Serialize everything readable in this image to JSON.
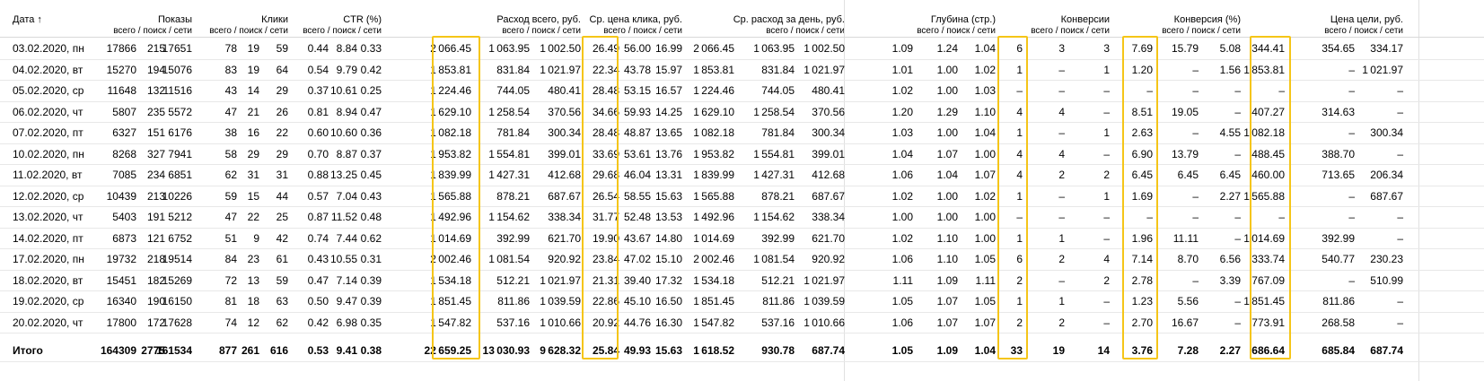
{
  "header": {
    "date": "Дата ↑",
    "groups": [
      {
        "label": "Показы",
        "sub": "всего / поиск / сети"
      },
      {
        "label": "Клики",
        "sub": "всего / поиск / сети"
      },
      {
        "label": "CTR (%)",
        "sub": "всего / поиск / сети"
      },
      {
        "label": "Расход всего, руб.",
        "sub": "всего / поиск / сети"
      },
      {
        "label": "Ср. цена клика, руб.",
        "sub": "всего / поиск / сети"
      },
      {
        "label": "Ср. расход за день, руб.",
        "sub": "всего / поиск / сети"
      },
      {
        "label": "Глубина (стр.)",
        "sub": "всего / поиск / сети"
      },
      {
        "label": "Конверсии",
        "sub": "всего / поиск / сети"
      },
      {
        "label": "Конверсия (%)",
        "sub": "всего / поиск / сети"
      },
      {
        "label": "Цена цели, руб.",
        "sub": "всего / поиск / сети"
      }
    ]
  },
  "rows": [
    {
      "date": "03.02.2020, пн",
      "v": [
        "17866",
        "215",
        "17651",
        "78",
        "19",
        "59",
        "0.44",
        "8.84",
        "0.33",
        "2066.45",
        "1063.95",
        "1002.50",
        "26.49",
        "56.00",
        "16.99",
        "2066.45",
        "1063.95",
        "1002.50",
        "1.09",
        "1.24",
        "1.04",
        "6",
        "3",
        "3",
        "7.69",
        "15.79",
        "5.08",
        "344.41",
        "354.65",
        "334.17"
      ]
    },
    {
      "date": "04.02.2020, вт",
      "v": [
        "15270",
        "194",
        "15076",
        "83",
        "19",
        "64",
        "0.54",
        "9.79",
        "0.42",
        "1853.81",
        "831.84",
        "1021.97",
        "22.34",
        "43.78",
        "15.97",
        "1853.81",
        "831.84",
        "1021.97",
        "1.01",
        "1.00",
        "1.02",
        "1",
        "–",
        "1",
        "1.20",
        "–",
        "1.56",
        "1853.81",
        "–",
        "1021.97"
      ]
    },
    {
      "date": "05.02.2020, ср",
      "v": [
        "11648",
        "132",
        "11516",
        "43",
        "14",
        "29",
        "0.37",
        "10.61",
        "0.25",
        "1224.46",
        "744.05",
        "480.41",
        "28.48",
        "53.15",
        "16.57",
        "1224.46",
        "744.05",
        "480.41",
        "1.02",
        "1.00",
        "1.03",
        "–",
        "–",
        "–",
        "–",
        "–",
        "–",
        "–",
        "–",
        "–"
      ]
    },
    {
      "date": "06.02.2020, чт",
      "v": [
        "5807",
        "235",
        "5572",
        "47",
        "21",
        "26",
        "0.81",
        "8.94",
        "0.47",
        "1629.10",
        "1258.54",
        "370.56",
        "34.66",
        "59.93",
        "14.25",
        "1629.10",
        "1258.54",
        "370.56",
        "1.20",
        "1.29",
        "1.10",
        "4",
        "4",
        "–",
        "8.51",
        "19.05",
        "–",
        "407.27",
        "314.63",
        "–"
      ]
    },
    {
      "date": "07.02.2020, пт",
      "v": [
        "6327",
        "151",
        "6176",
        "38",
        "16",
        "22",
        "0.60",
        "10.60",
        "0.36",
        "1082.18",
        "781.84",
        "300.34",
        "28.48",
        "48.87",
        "13.65",
        "1082.18",
        "781.84",
        "300.34",
        "1.03",
        "1.00",
        "1.04",
        "1",
        "–",
        "1",
        "2.63",
        "–",
        "4.55",
        "1082.18",
        "–",
        "300.34"
      ]
    },
    {
      "date": "10.02.2020, пн",
      "v": [
        "8268",
        "327",
        "7941",
        "58",
        "29",
        "29",
        "0.70",
        "8.87",
        "0.37",
        "1953.82",
        "1554.81",
        "399.01",
        "33.69",
        "53.61",
        "13.76",
        "1953.82",
        "1554.81",
        "399.01",
        "1.04",
        "1.07",
        "1.00",
        "4",
        "4",
        "–",
        "6.90",
        "13.79",
        "–",
        "488.45",
        "388.70",
        "–"
      ]
    },
    {
      "date": "11.02.2020, вт",
      "v": [
        "7085",
        "234",
        "6851",
        "62",
        "31",
        "31",
        "0.88",
        "13.25",
        "0.45",
        "1839.99",
        "1427.31",
        "412.68",
        "29.68",
        "46.04",
        "13.31",
        "1839.99",
        "1427.31",
        "412.68",
        "1.06",
        "1.04",
        "1.07",
        "4",
        "2",
        "2",
        "6.45",
        "6.45",
        "6.45",
        "460.00",
        "713.65",
        "206.34"
      ]
    },
    {
      "date": "12.02.2020, ср",
      "v": [
        "10439",
        "213",
        "10226",
        "59",
        "15",
        "44",
        "0.57",
        "7.04",
        "0.43",
        "1565.88",
        "878.21",
        "687.67",
        "26.54",
        "58.55",
        "15.63",
        "1565.88",
        "878.21",
        "687.67",
        "1.02",
        "1.00",
        "1.02",
        "1",
        "–",
        "1",
        "1.69",
        "–",
        "2.27",
        "1565.88",
        "–",
        "687.67"
      ]
    },
    {
      "date": "13.02.2020, чт",
      "v": [
        "5403",
        "191",
        "5212",
        "47",
        "22",
        "25",
        "0.87",
        "11.52",
        "0.48",
        "1492.96",
        "1154.62",
        "338.34",
        "31.77",
        "52.48",
        "13.53",
        "1492.96",
        "1154.62",
        "338.34",
        "1.00",
        "1.00",
        "1.00",
        "–",
        "–",
        "–",
        "–",
        "–",
        "–",
        "–",
        "–",
        "–"
      ]
    },
    {
      "date": "14.02.2020, пт",
      "v": [
        "6873",
        "121",
        "6752",
        "51",
        "9",
        "42",
        "0.74",
        "7.44",
        "0.62",
        "1014.69",
        "392.99",
        "621.70",
        "19.90",
        "43.67",
        "14.80",
        "1014.69",
        "392.99",
        "621.70",
        "1.02",
        "1.10",
        "1.00",
        "1",
        "1",
        "–",
        "1.96",
        "11.11",
        "–",
        "1014.69",
        "392.99",
        "–"
      ]
    },
    {
      "date": "17.02.2020, пн",
      "v": [
        "19732",
        "218",
        "19514",
        "84",
        "23",
        "61",
        "0.43",
        "10.55",
        "0.31",
        "2002.46",
        "1081.54",
        "920.92",
        "23.84",
        "47.02",
        "15.10",
        "2002.46",
        "1081.54",
        "920.92",
        "1.06",
        "1.10",
        "1.05",
        "6",
        "2",
        "4",
        "7.14",
        "8.70",
        "6.56",
        "333.74",
        "540.77",
        "230.23"
      ]
    },
    {
      "date": "18.02.2020, вт",
      "v": [
        "15451",
        "182",
        "15269",
        "72",
        "13",
        "59",
        "0.47",
        "7.14",
        "0.39",
        "1534.18",
        "512.21",
        "1021.97",
        "21.31",
        "39.40",
        "17.32",
        "1534.18",
        "512.21",
        "1021.97",
        "1.11",
        "1.09",
        "1.11",
        "2",
        "–",
        "2",
        "2.78",
        "–",
        "3.39",
        "767.09",
        "–",
        "510.99"
      ]
    },
    {
      "date": "19.02.2020, ср",
      "v": [
        "16340",
        "190",
        "16150",
        "81",
        "18",
        "63",
        "0.50",
        "9.47",
        "0.39",
        "1851.45",
        "811.86",
        "1039.59",
        "22.86",
        "45.10",
        "16.50",
        "1851.45",
        "811.86",
        "1039.59",
        "1.05",
        "1.07",
        "1.05",
        "1",
        "1",
        "–",
        "1.23",
        "5.56",
        "–",
        "1851.45",
        "811.86",
        "–"
      ]
    },
    {
      "date": "20.02.2020, чт",
      "v": [
        "17800",
        "172",
        "17628",
        "74",
        "12",
        "62",
        "0.42",
        "6.98",
        "0.35",
        "1547.82",
        "537.16",
        "1010.66",
        "20.92",
        "44.76",
        "16.30",
        "1547.82",
        "537.16",
        "1010.66",
        "1.06",
        "1.07",
        "1.07",
        "2",
        "2",
        "–",
        "2.70",
        "16.67",
        "–",
        "773.91",
        "268.58",
        "–"
      ]
    }
  ],
  "total": {
    "date": "Итого",
    "v": [
      "164309",
      "2775",
      "161534",
      "877",
      "261",
      "616",
      "0.53",
      "9.41",
      "0.38",
      "22659.25",
      "13030.93",
      "9628.32",
      "25.84",
      "49.93",
      "15.63",
      "1618.52",
      "930.78",
      "687.74",
      "1.05",
      "1.09",
      "1.04",
      "33",
      "19",
      "14",
      "3.76",
      "7.28",
      "2.27",
      "686.64",
      "685.84",
      "687.74"
    ]
  },
  "highlight_color": "#f5c518"
}
